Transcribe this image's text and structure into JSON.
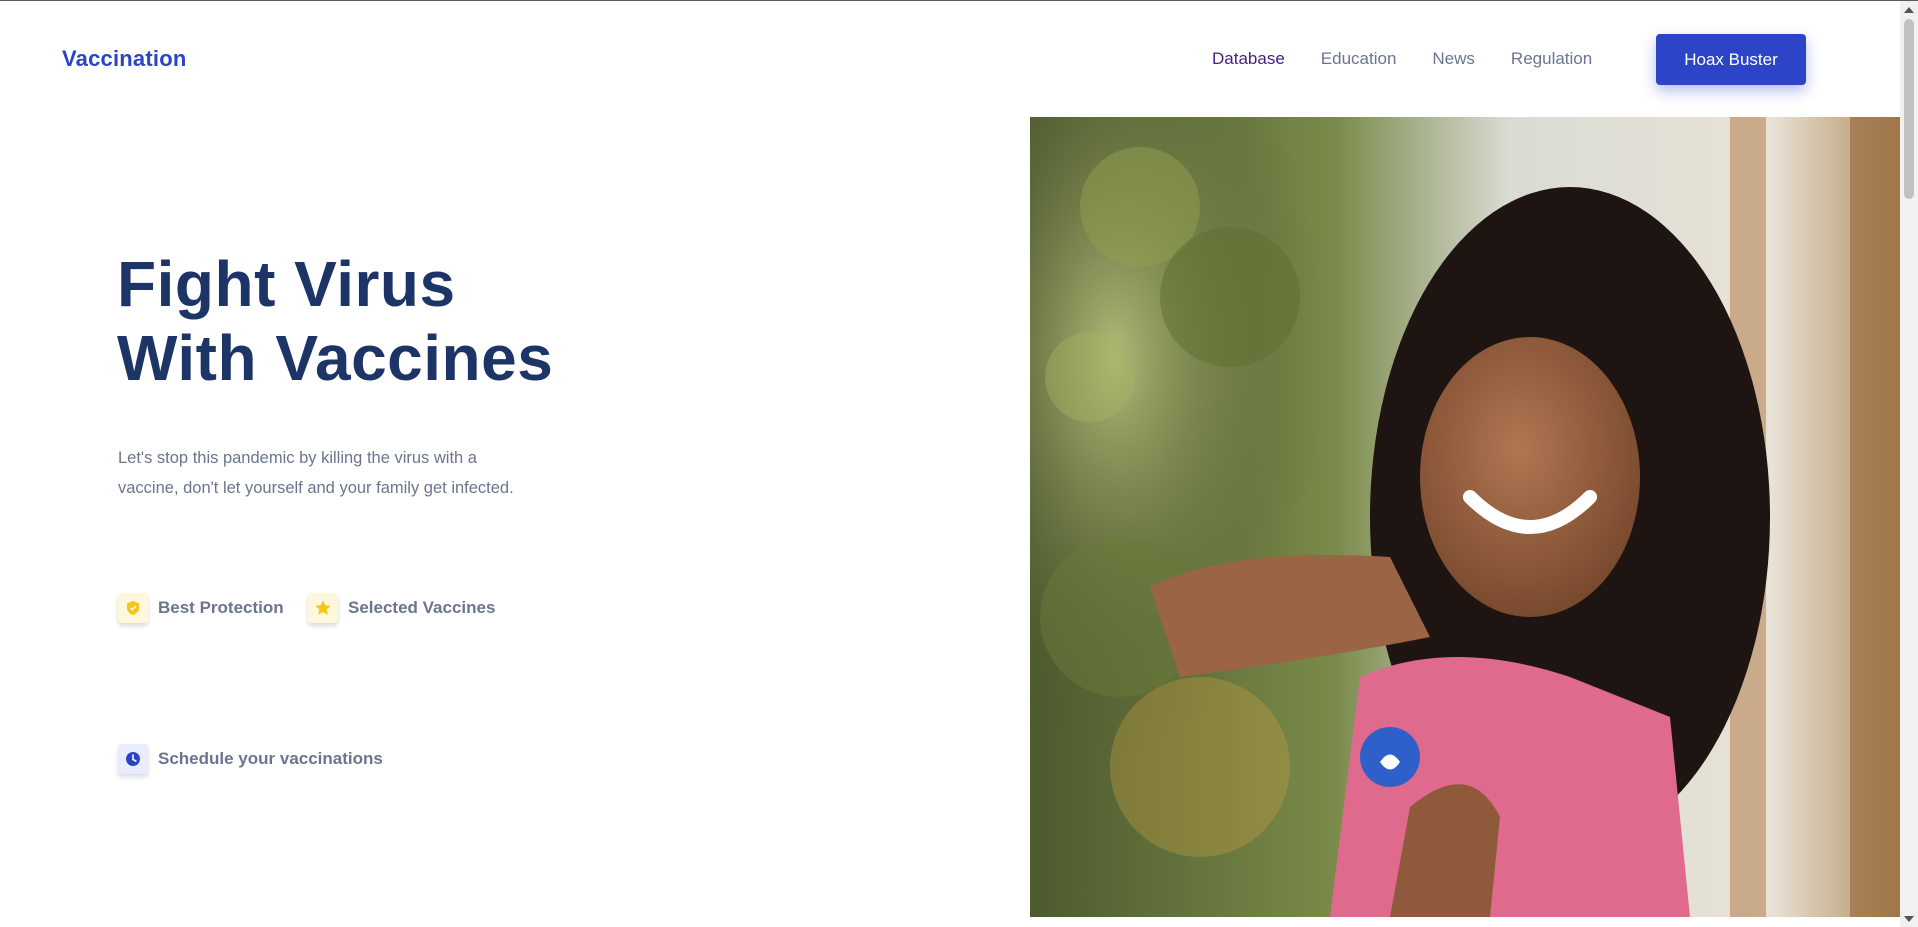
{
  "header": {
    "brand": "Vaccination",
    "nav": [
      "Database",
      "Education",
      "News",
      "Regulation"
    ],
    "cta": "Hoax Buster"
  },
  "hero": {
    "title_line1": "Fight Virus",
    "title_line2": "With Vaccines",
    "description": "Let's stop this pandemic by killing the virus with a vaccine, don't let yourself and your family get infected.",
    "features": [
      {
        "icon": "shield-icon",
        "label": "Best Protection"
      },
      {
        "icon": "star-icon",
        "label": "Selected Vaccines"
      },
      {
        "icon": "clock-icon",
        "label": "Schedule your vaccinations"
      }
    ],
    "image_alt": "vaccinated-girl-photo"
  },
  "colors": {
    "brand": "#2c44c8",
    "title": "#1d3466",
    "muted": "#6b7590",
    "active_nav": "#4a1e7e",
    "icon_yellow": "#f5c518"
  }
}
